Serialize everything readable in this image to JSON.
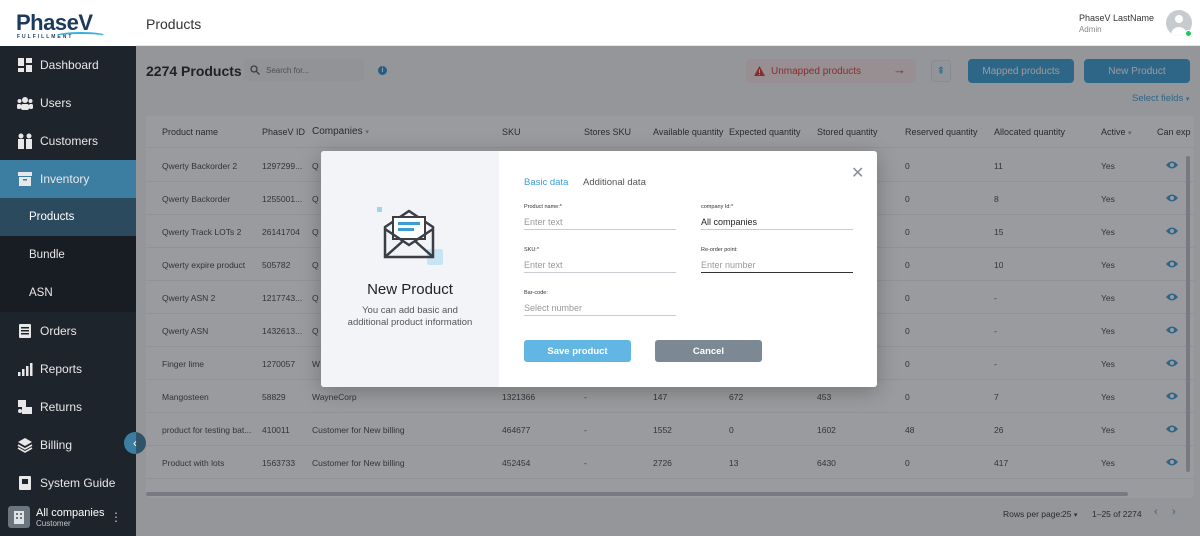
{
  "brand": {
    "logo": "PhaseV",
    "logo_sub": "FULFILLMENT",
    "accent": "#3b9ed6"
  },
  "sidebar": {
    "items": [
      {
        "label": "Dashboard",
        "icon": "dashboard-icon"
      },
      {
        "label": "Users",
        "icon": "users-icon"
      },
      {
        "label": "Customers",
        "icon": "customers-icon"
      },
      {
        "label": "Inventory",
        "icon": "inventory-icon"
      },
      {
        "label": "Products"
      },
      {
        "label": "Bundle"
      },
      {
        "label": "ASN"
      },
      {
        "label": "Orders",
        "icon": "orders-icon"
      },
      {
        "label": "Reports",
        "icon": "reports-icon"
      },
      {
        "label": "Returns",
        "icon": "returns-icon"
      },
      {
        "label": "Billing",
        "icon": "billing-icon"
      },
      {
        "label": "System Guide",
        "icon": "guide-icon"
      }
    ],
    "company": {
      "name": "All companies",
      "role": "Customer"
    }
  },
  "header": {
    "title": "Products",
    "user_name": "PhaseV LastName",
    "user_role": "Admin"
  },
  "toolbar": {
    "count": "2274 Products",
    "search_placeholder": "Search for...",
    "unmapped": "Unmapped products",
    "mapped": "Mapped products",
    "new_product": "New Product",
    "select_fields": "Select fields"
  },
  "table": {
    "headers": [
      "Product name",
      "PhaseV ID",
      "Companies",
      "SKU",
      "Stores SKU",
      "Available quantity",
      "Expected quantity",
      "Stored quantity",
      "Reserved quantity",
      "Allocated quantity",
      "Active",
      "Can exp"
    ],
    "rows": [
      [
        "Qwerty Backorder 2",
        "1297299...",
        "Q",
        "",
        "",
        "",
        "",
        "",
        "0",
        "11",
        "Yes"
      ],
      [
        "Qwerty Backorder",
        "1255001...",
        "Q",
        "",
        "",
        "",
        "",
        "",
        "0",
        "8",
        "Yes"
      ],
      [
        "Qwerty Track LOTs 2",
        "26141704",
        "Q",
        "",
        "",
        "",
        "",
        "",
        "0",
        "15",
        "Yes"
      ],
      [
        "Qwerty expire product",
        "505782",
        "Q",
        "",
        "",
        "",
        "",
        "",
        "0",
        "10",
        "Yes"
      ],
      [
        "Qwerty ASN 2",
        "1217743...",
        "Q",
        "",
        "",
        "",
        "",
        "",
        "0",
        "-",
        "Yes"
      ],
      [
        "Qwerty ASN",
        "1432613...",
        "Q",
        "",
        "",
        "",
        "",
        "",
        "0",
        "-",
        "Yes"
      ],
      [
        "Finger lime",
        "1270057",
        "W",
        "",
        "",
        "",
        "",
        "",
        "0",
        "-",
        "Yes"
      ],
      [
        "Mangosteen",
        "58829",
        "WayneCorp",
        "1321366",
        "-",
        "147",
        "672",
        "453",
        "0",
        "7",
        "Yes"
      ],
      [
        "product for testing bat...",
        "410011",
        "Customer for New billing",
        "464677",
        "-",
        "1552",
        "0",
        "1602",
        "48",
        "26",
        "Yes"
      ],
      [
        "Product with lots",
        "1563733",
        "Customer for New billing",
        "452454",
        "-",
        "2726",
        "13",
        "6430",
        "0",
        "417",
        "Yes"
      ]
    ]
  },
  "pager": {
    "rows_label": "Rows per page:",
    "rows_value": "25",
    "range": "1–25 of 2274"
  },
  "modal": {
    "title": "New Product",
    "description": "You can add basic and additional product information",
    "tab_basic": "Basic data",
    "tab_additional": "Additional data",
    "product_name_label": "Product name:*",
    "product_name_placeholder": "Enter text",
    "company_label": "company Id:*",
    "company_value": "All companies",
    "sku_label": "SKU:*",
    "sku_placeholder": "Enter text",
    "reorder_label": "Re-order point:",
    "reorder_placeholder": "Enter number",
    "barcode_label": "Bar-code:",
    "barcode_placeholder": "Select number",
    "save": "Save product",
    "cancel": "Cancel"
  }
}
